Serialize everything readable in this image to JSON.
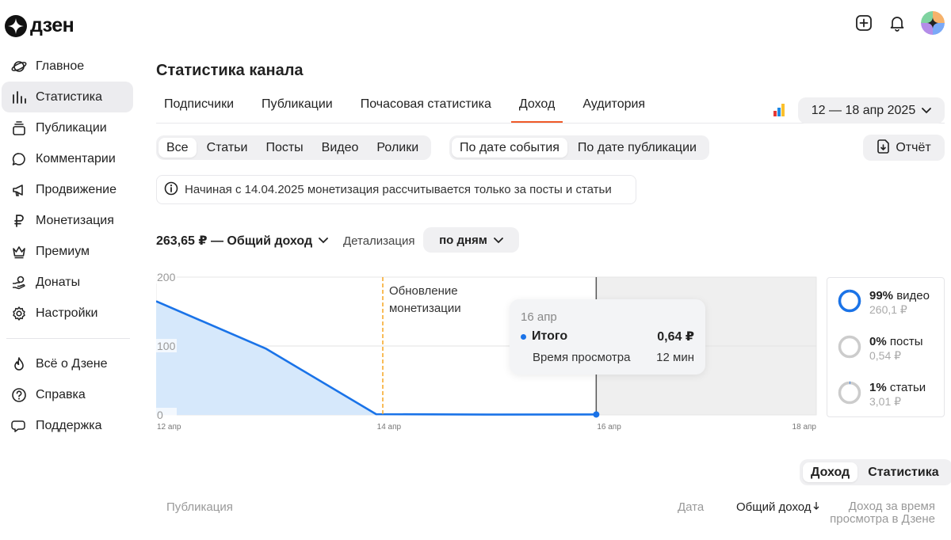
{
  "brand": {
    "name": "дзен"
  },
  "page": {
    "title": "Статистика канала"
  },
  "sidebar": {
    "items": [
      {
        "label": "Главное",
        "icon": "planet-icon",
        "active": false
      },
      {
        "label": "Статистика",
        "icon": "bar-chart-icon",
        "active": true
      },
      {
        "label": "Публикации",
        "icon": "stack-icon",
        "active": false
      },
      {
        "label": "Комментарии",
        "icon": "comment-icon",
        "active": false
      },
      {
        "label": "Продвижение",
        "icon": "megaphone-icon",
        "active": false
      },
      {
        "label": "Монетизация",
        "icon": "ruble-icon",
        "active": false
      },
      {
        "label": "Премиум",
        "icon": "crown-icon",
        "active": false
      },
      {
        "label": "Донаты",
        "icon": "hand-coin-icon",
        "active": false
      },
      {
        "label": "Настройки",
        "icon": "gear-icon",
        "active": false
      }
    ],
    "secondary": [
      {
        "label": "Всё о Дзене",
        "icon": "flame-icon"
      },
      {
        "label": "Справка",
        "icon": "question-icon"
      },
      {
        "label": "Поддержка",
        "icon": "chat-icon"
      }
    ]
  },
  "tabs": [
    {
      "label": "Подписчики",
      "active": false
    },
    {
      "label": "Публикации",
      "active": false
    },
    {
      "label": "Почасовая статистика",
      "active": false
    },
    {
      "label": "Доход",
      "active": true
    },
    {
      "label": "Аудитория",
      "active": false
    }
  ],
  "date_range": "12 — 18 апр 2025",
  "content_filter": [
    "Все",
    "Статьи",
    "Посты",
    "Видео",
    "Ролики"
  ],
  "date_filter": [
    "По дате события",
    "По дате публикации"
  ],
  "report_label": "Отчёт",
  "notice": "Начиная с 14.04.2025 монетизация рассчитывается только за посты и статьи",
  "income_selector": "263,65 ₽ — Общий доход",
  "detail": {
    "label": "Детализация",
    "value": "по дням"
  },
  "chart_data": {
    "type": "area",
    "x": [
      "12 апр",
      "13 апр",
      "14 апр",
      "15 апр",
      "16 апр"
    ],
    "y": [
      165,
      96,
      1,
      0.5,
      0.64
    ],
    "x_ticks": [
      "12 апр",
      "14 апр",
      "16 апр",
      "18 апр"
    ],
    "y_ticks": [
      "0",
      "100",
      "200"
    ],
    "ylim": [
      0,
      200
    ],
    "annotation": "Обновление\nмонетизации",
    "series_color": "#1a73e8"
  },
  "tooltip": {
    "date": "16 апр",
    "total_label": "Итого",
    "total_value": "0,64 ₽",
    "watch_label": "Время просмотра",
    "watch_value": "12 мин"
  },
  "breakdown": [
    {
      "pct": "99%",
      "name": "видео",
      "amount": "260,1 ₽",
      "fraction": 0.99
    },
    {
      "pct": "0%",
      "name": "посты",
      "amount": "0,54 ₽",
      "fraction": 0.0
    },
    {
      "pct": "1%",
      "name": "статьи",
      "amount": "3,01 ₽",
      "fraction": 0.01
    }
  ],
  "bottom_toggle": [
    "Доход",
    "Статистика"
  ],
  "table_headers": {
    "publication": "Публикация",
    "date": "Дата",
    "total_income": "Общий доход",
    "watch_income_line1": "Доход за время",
    "watch_income_line2": "просмотра в Дзене"
  },
  "colors": {
    "accent": "#1a73e8",
    "tab_underline": "#f05a28",
    "annotation": "#f5a623"
  }
}
